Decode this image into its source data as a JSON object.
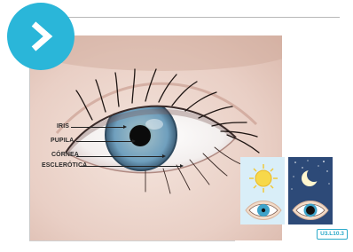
{
  "nav": {
    "icon": "chevron-right-icon",
    "color": "#2ab6d9"
  },
  "labels": {
    "iris": "IRIS",
    "pupila": "PUPILA",
    "cornea": "CÓRNEA",
    "esclerotica": "ESCLERÓTICA"
  },
  "panels": [
    {
      "icon": "sun-icon",
      "background": "#d9eef8",
      "pupil": "small"
    },
    {
      "icon": "moon-icon",
      "background": "#2d4a78",
      "pupil": "large"
    }
  ],
  "badge": {
    "code": "U3.L10.3"
  }
}
